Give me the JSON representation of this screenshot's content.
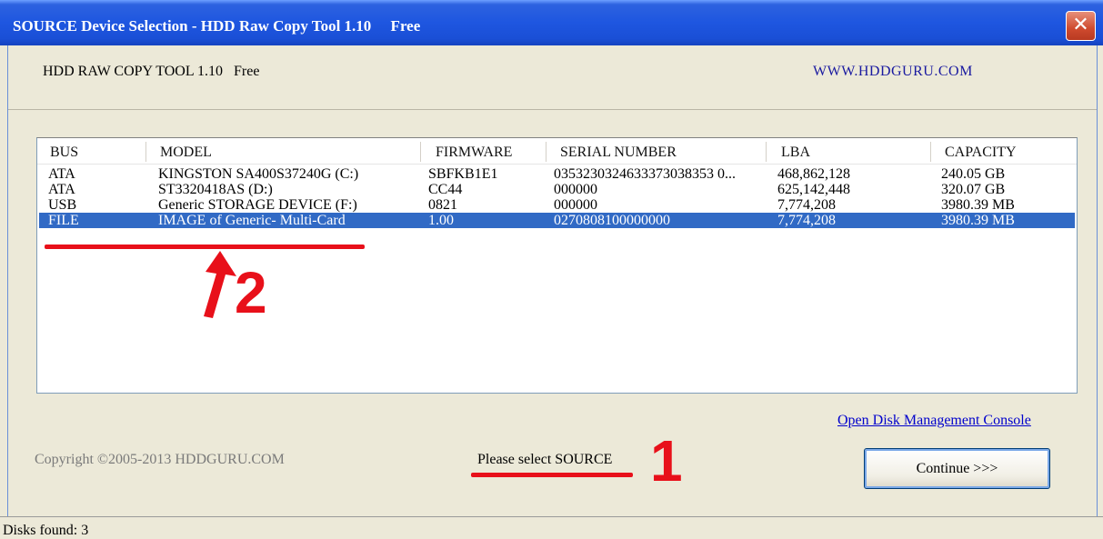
{
  "window": {
    "title": "SOURCE Device Selection - HDD Raw Copy Tool 1.10     Free",
    "close_glyph": "✕"
  },
  "header": {
    "app_name": "HDD RAW COPY TOOL 1.10   Free",
    "site": "WWW.HDDGURU.COM"
  },
  "table": {
    "columns": [
      "BUS",
      "MODEL",
      "FIRMWARE",
      "SERIAL NUMBER",
      "LBA",
      "CAPACITY"
    ],
    "rows": [
      [
        "ATA",
        "KINGSTON SA400S37240G (C:)",
        "SBFKB1E1",
        "0353230324633373038353 0...",
        "468,862,128",
        "240.05 GB"
      ],
      [
        "ATA",
        "ST3320418AS (D:)",
        "CC44",
        "000000",
        "625,142,448",
        "320.07 GB"
      ],
      [
        "USB",
        "Generic STORAGE DEVICE (F:)",
        "0821",
        "000000",
        "7,774,208",
        "3980.39 MB"
      ],
      [
        "FILE",
        "IMAGE of Generic- Multi-Card",
        "1.00",
        "0270808100000000",
        "7,774,208",
        "3980.39 MB"
      ]
    ],
    "selected_index": 3
  },
  "links": {
    "disk_management": "Open Disk Management Console"
  },
  "footer": {
    "copyright": "Copyright ©2005-2013 HDDGURU.COM",
    "status_message": "Please select SOURCE",
    "continue_label": "Continue >>>"
  },
  "statusbar": {
    "disks_found": "Disks found: 3"
  },
  "annotations": {
    "step1": "1",
    "step2": "2",
    "arrow_glyph": "arrow-up-icon",
    "color": "#e8101a"
  },
  "colors": {
    "titlebar": "#1e56e0",
    "selection": "#316ac5",
    "background": "#ece9d8"
  }
}
